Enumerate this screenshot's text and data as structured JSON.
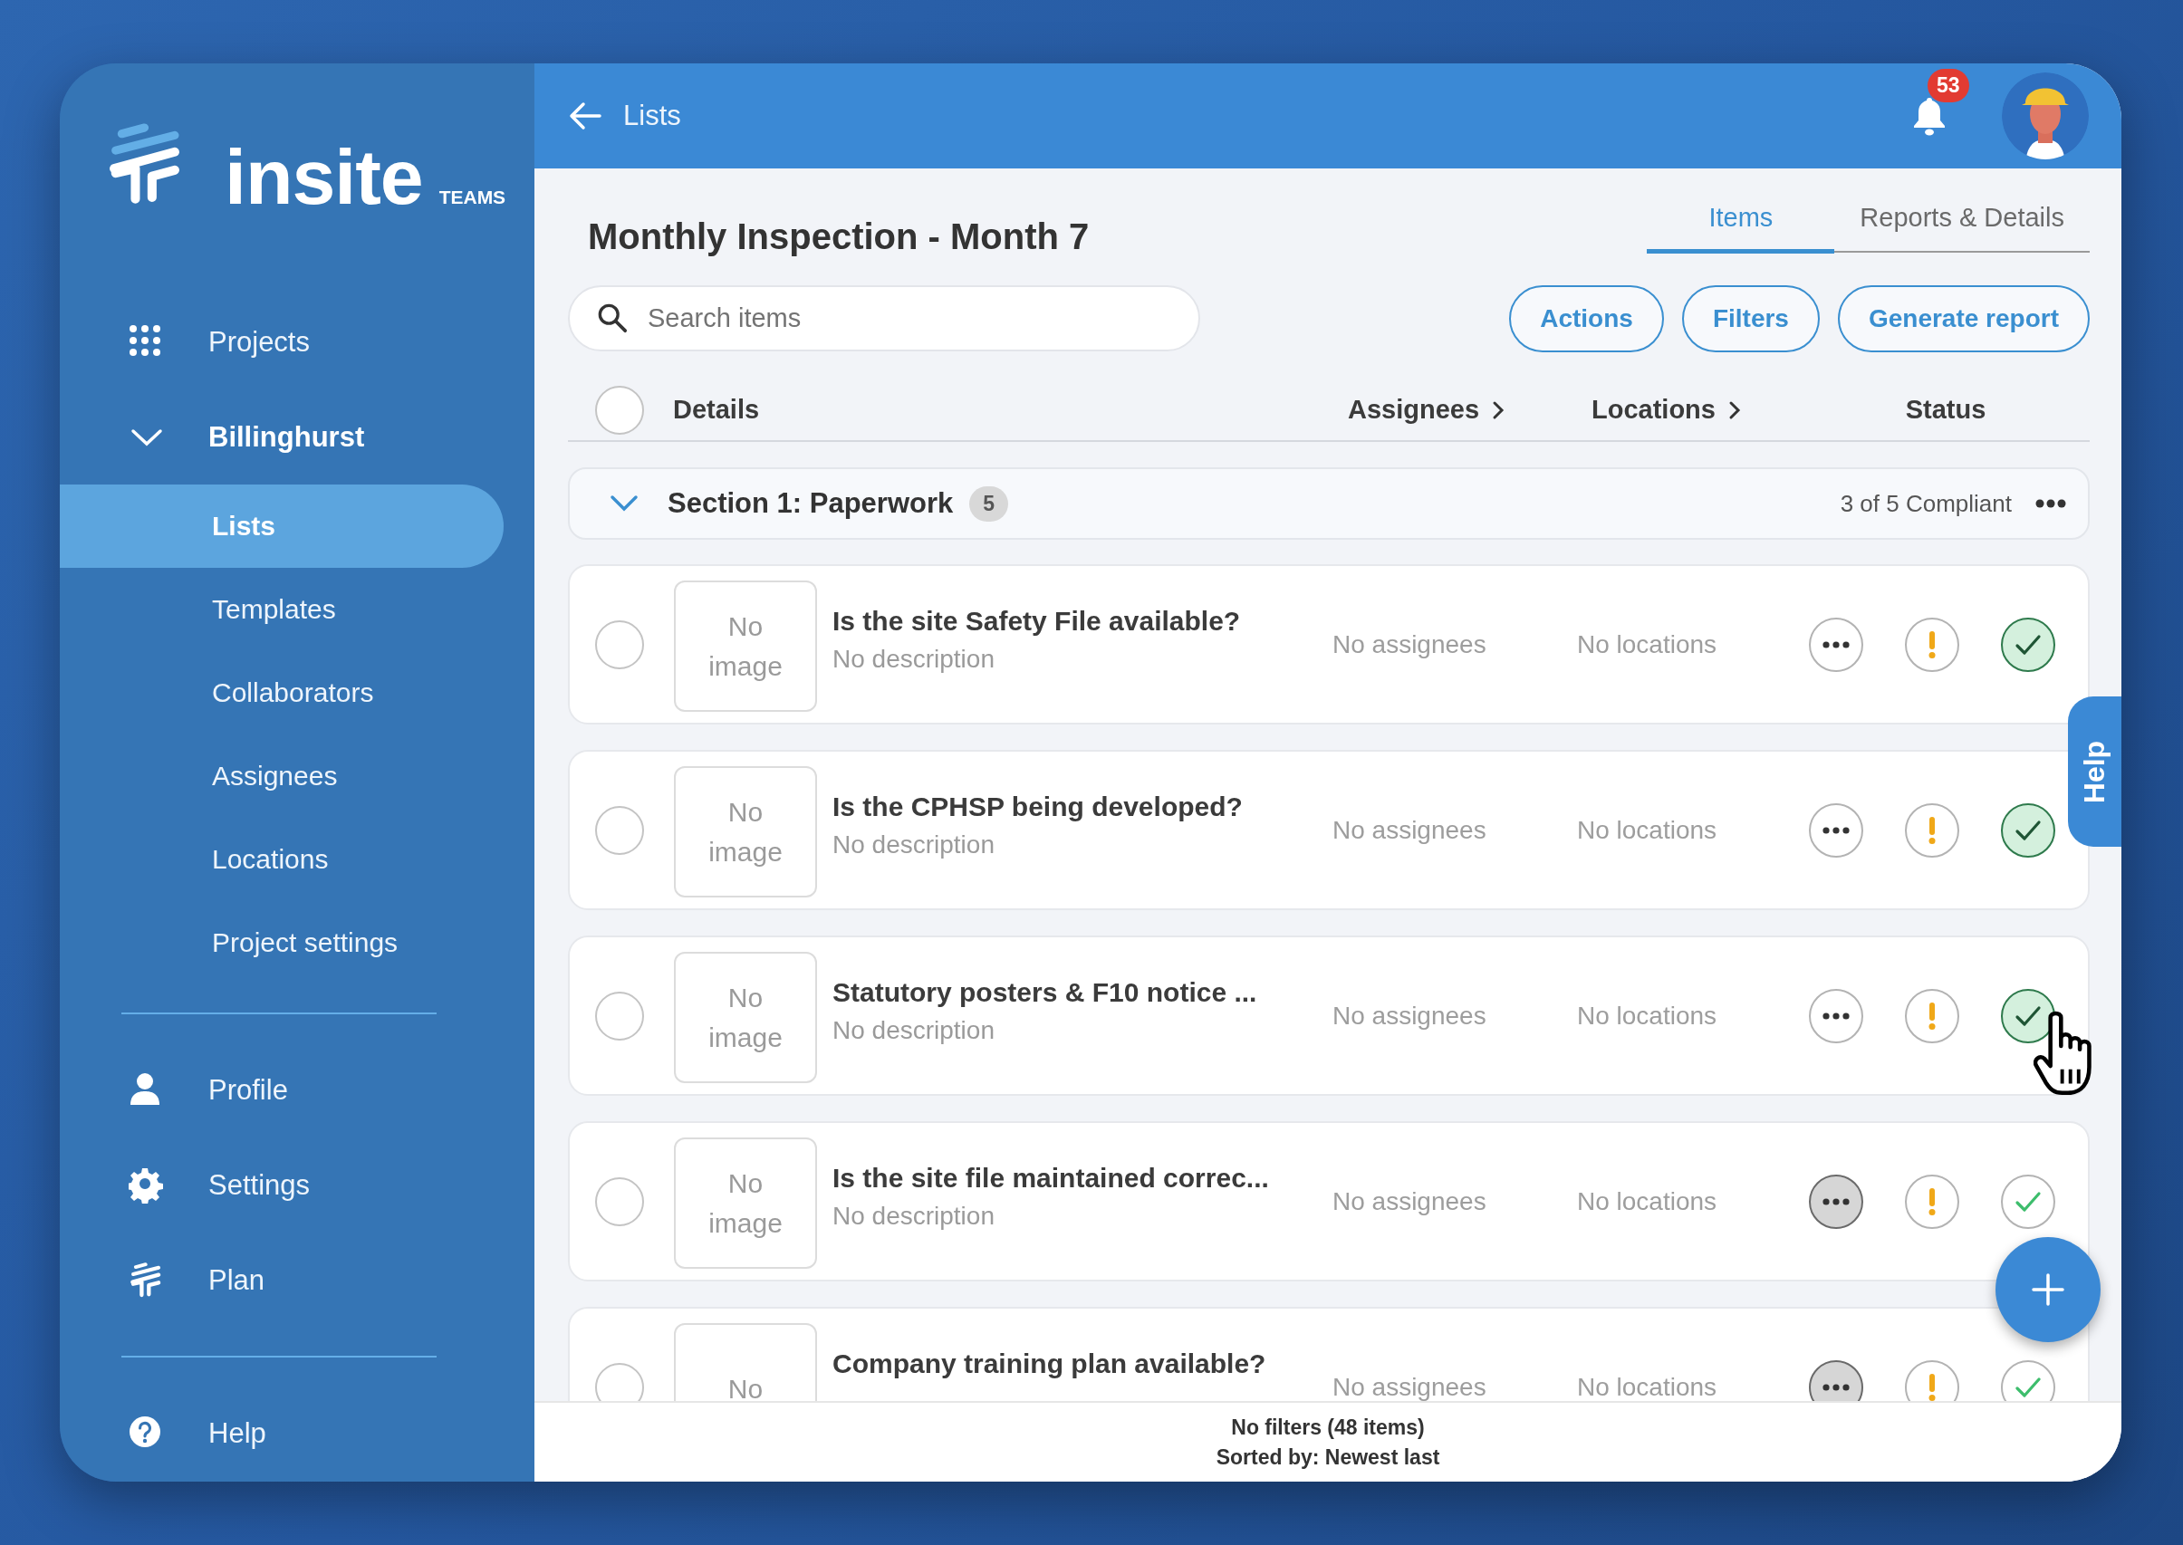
{
  "brand": {
    "name": "insite",
    "edition": "TEAMS"
  },
  "sidebar": {
    "groups": [
      {
        "items": [
          {
            "label": "Projects",
            "selected": false
          },
          {
            "label": "Billinghurst",
            "selected": false,
            "expanded": true,
            "children": [
              {
                "label": "Lists",
                "selected": true
              },
              {
                "label": "Templates",
                "selected": false
              },
              {
                "label": "Collaborators",
                "selected": false
              },
              {
                "label": "Assignees",
                "selected": false
              },
              {
                "label": "Locations",
                "selected": false
              },
              {
                "label": "Project settings",
                "selected": false
              }
            ]
          }
        ]
      },
      {
        "items": [
          {
            "label": "Profile",
            "selected": false
          },
          {
            "label": "Settings",
            "selected": false
          },
          {
            "label": "Plan",
            "selected": false
          }
        ]
      },
      {
        "items": [
          {
            "label": "Help",
            "selected": false
          }
        ]
      }
    ]
  },
  "header": {
    "back_label": "Lists",
    "notifications": "53"
  },
  "title": "Monthly Inspection - Month 7",
  "tabs": [
    {
      "label": "Items",
      "selected": true
    },
    {
      "label": "Reports & Details",
      "selected": false
    }
  ],
  "search": {
    "placeholder": "Search items"
  },
  "actions": [
    "Actions",
    "Filters",
    "Generate report"
  ],
  "columns": {
    "checked": false,
    "details": "Details",
    "assignees": "Assignees",
    "locations": "Locations",
    "status": "Status"
  },
  "section": {
    "title": "Section 1: Paperwork",
    "count": "5",
    "summary": "3 of 5 Compliant",
    "expanded": true
  },
  "items": [
    {
      "checked": false,
      "image_text": "No image",
      "title": "Is the site Safety File available?",
      "description": "No description",
      "assignees": "No assignees",
      "locations": "No locations",
      "notes": false,
      "compliant": true
    },
    {
      "checked": false,
      "image_text": "No image",
      "title": "Is the CPHSP being developed?",
      "description": "No description",
      "assignees": "No assignees",
      "locations": "No locations",
      "notes": false,
      "compliant": true
    },
    {
      "checked": false,
      "image_text": "No image",
      "title": "Statutory posters & F10 notice ...",
      "description": "No description",
      "assignees": "No assignees",
      "locations": "No locations",
      "notes": false,
      "compliant": true
    },
    {
      "checked": false,
      "image_text": "No image",
      "title": "Is the site file maintained correc...",
      "description": "No description",
      "assignees": "No assignees",
      "locations": "No locations",
      "notes": true,
      "compliant": false
    },
    {
      "checked": false,
      "image_text": "No",
      "title": "Company training plan available?",
      "assignees": "No assignees",
      "locations": "No locations",
      "notes": true,
      "compliant": false
    }
  ],
  "footer": {
    "filters": "No filters (48 items)",
    "sort": "Sorted by: Newest last"
  },
  "help_tab": "Help"
}
